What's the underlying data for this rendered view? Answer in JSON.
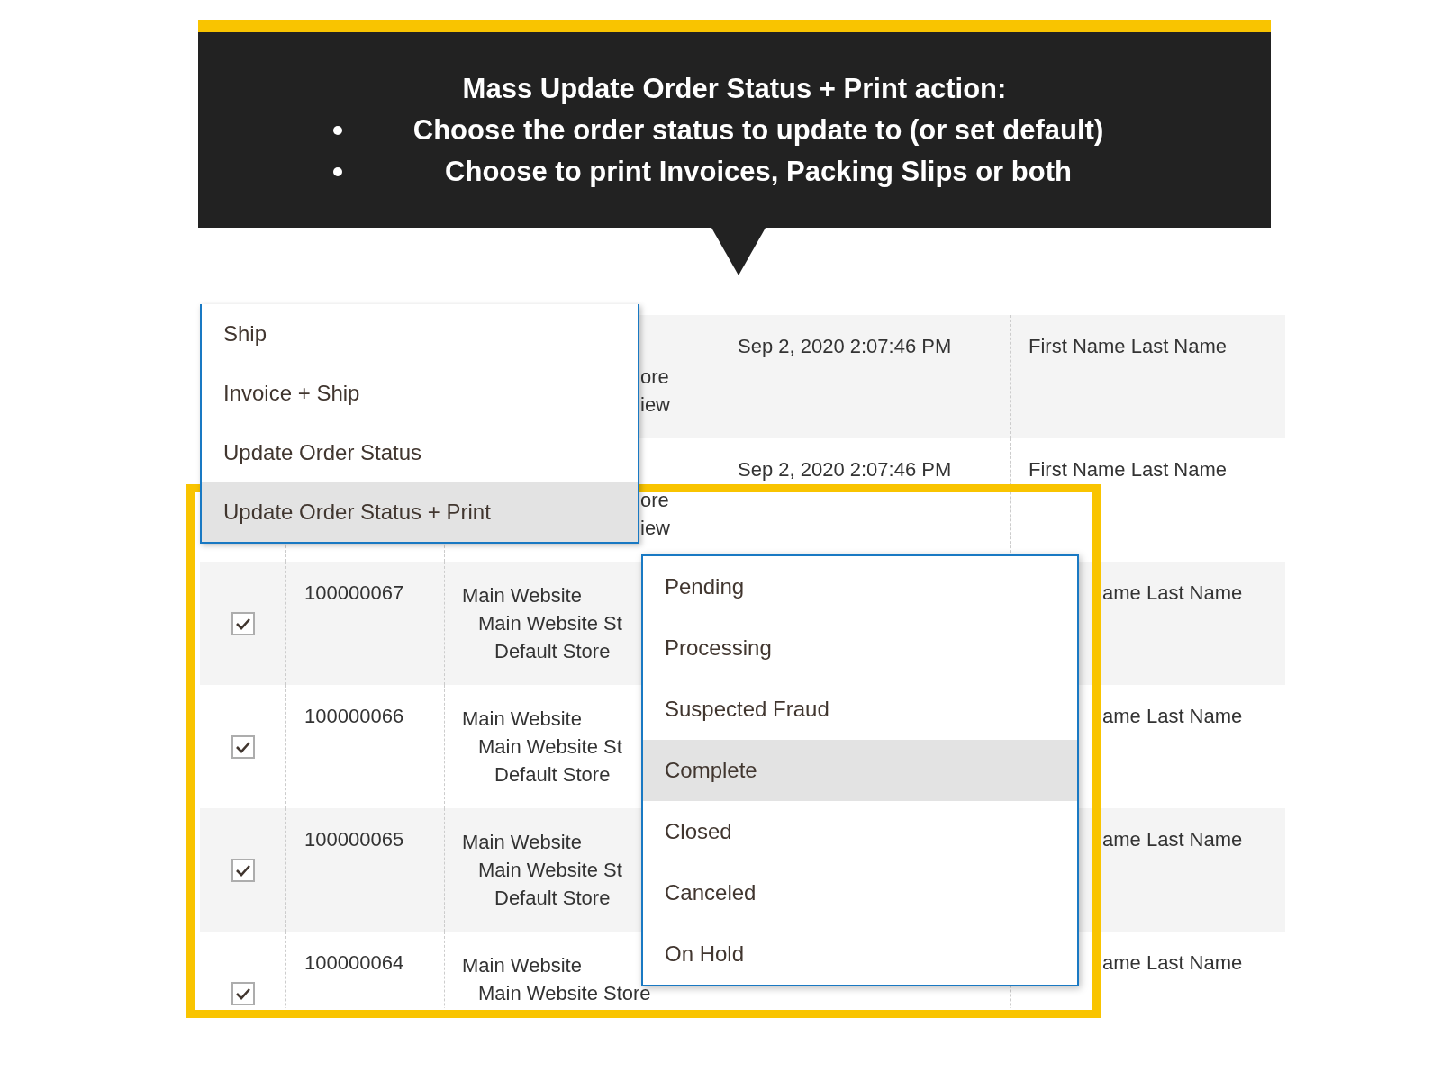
{
  "callout": {
    "title": "Mass Update Order Status + Print action:",
    "bullets": [
      "Choose the order status to update to (or set default)",
      "Choose to print Invoices, Packing Slips or both"
    ]
  },
  "orders_grid": {
    "rows": [
      {
        "kind": "covered",
        "website": [
          "ore",
          "iew"
        ],
        "purchase_date": "Sep 2, 2020 2:07:46 PM",
        "customer": "First Name Last Name"
      },
      {
        "kind": "covered",
        "website": [
          "ore",
          "iew"
        ],
        "purchase_date": "Sep 2, 2020 2:07:46 PM",
        "customer": "First Name Last Name"
      },
      {
        "kind": "partial",
        "checked": true,
        "id": "100000067",
        "website": [
          "Main Website",
          "Main Website St",
          "Default Store"
        ],
        "customer": "ame Last Name"
      },
      {
        "kind": "partial",
        "checked": true,
        "id": "100000066",
        "website": [
          "Main Website",
          "Main Website St",
          "Default Store"
        ],
        "customer": "ame Last Name"
      },
      {
        "kind": "partial",
        "checked": true,
        "id": "100000065",
        "website": [
          "Main Website",
          "Main Website St",
          "Default Store"
        ],
        "customer": "ame Last Name"
      },
      {
        "kind": "partial",
        "checked": true,
        "id": "100000064",
        "website": [
          "Main Website",
          "Main Website Store"
        ],
        "customer": "ame Last Name"
      }
    ]
  },
  "actions_menu": {
    "items": [
      {
        "label": "Ship",
        "selected": false
      },
      {
        "label": "Invoice + Ship",
        "selected": false
      },
      {
        "label": "Update Order Status",
        "selected": false
      },
      {
        "label": "Update Order Status + Print",
        "selected": true
      }
    ]
  },
  "status_dropdown": {
    "items": [
      {
        "label": "Pending",
        "selected": false
      },
      {
        "label": "Processing",
        "selected": false
      },
      {
        "label": "Suspected Fraud",
        "selected": false
      },
      {
        "label": "Complete",
        "selected": true
      },
      {
        "label": "Closed",
        "selected": false
      },
      {
        "label": "Canceled",
        "selected": false
      },
      {
        "label": "On Hold",
        "selected": false
      }
    ]
  }
}
